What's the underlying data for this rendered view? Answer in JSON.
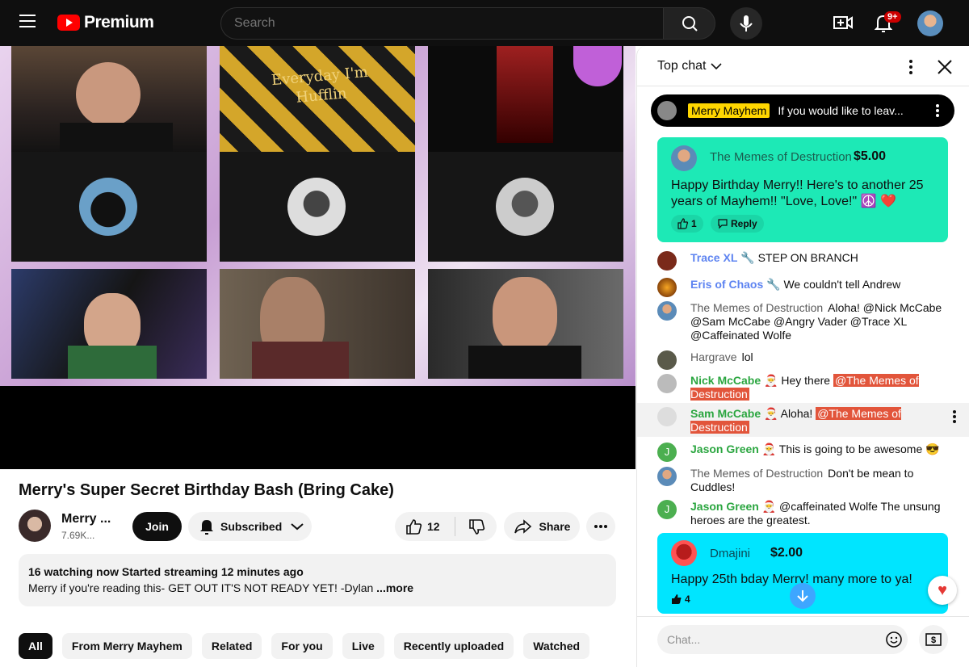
{
  "header": {
    "brand": "Premium",
    "search_placeholder": "Search",
    "notif_badge": "9+"
  },
  "video": {
    "tile_text": "Everyday I'm Hufflin"
  },
  "info": {
    "title": "Merry's Super Secret Birthday Bash (Bring Cake)",
    "channel": "Merry ...",
    "subscribers": "7.69K...",
    "join": "Join",
    "subscribed": "Subscribed",
    "likes": "12",
    "share": "Share",
    "desc_stats": "16 watching now  Started streaming 12 minutes ago",
    "desc_text": "Merry if you're reading this- GET OUT IT'S NOT READY YET! -Dylan",
    "desc_more": "...more"
  },
  "chips": [
    "All",
    "From Merry Mayhem",
    "Related",
    "For you",
    "Live",
    "Recently uploaded",
    "Watched"
  ],
  "chat": {
    "title": "Top chat",
    "pinned_author": "Merry Mayhem",
    "pinned_text": "If you would like to leav...",
    "input_placeholder": "Chat...",
    "superchat1": {
      "author": "The Memes of Destruction",
      "amount": "$5.00",
      "text": "Happy Birthday Merry!! Here's to another 25 years of Mayhem!! \"Love, Love!\" ☮️ ❤️",
      "likes": "1",
      "reply": "Reply"
    },
    "superchat2": {
      "author": "Dmajini",
      "amount": "$2.00",
      "text": "Happy 25th bday Merry! many more to ya!",
      "likes": "4"
    },
    "messages": [
      {
        "author": "Trace XL",
        "text": "STEP ON BRANCH"
      },
      {
        "author": "Eris of Chaos",
        "text": "We couldn't tell Andrew"
      },
      {
        "author": "The Memes of Destruction",
        "text": "Aloha! @Nick McCabe @Sam McCabe @Angry Vader @Trace XL @Caffeinated Wolfe"
      },
      {
        "author": "Hargrave",
        "text": "lol"
      },
      {
        "author": "Nick McCabe",
        "text": "Hey there",
        "mention": "@The Memes of Destruction"
      },
      {
        "author": "Sam McCabe",
        "text": "Aloha!",
        "mention": "@The Memes of Destruction"
      },
      {
        "author": "Jason Green",
        "text": "This is going to be awesome 😎"
      },
      {
        "author": "The Memes of Destruction",
        "text": "Don't be mean to Cuddles!"
      },
      {
        "author": "Jason Green",
        "text": "@caffeinated Wolfe The unsung heroes are the greatest."
      }
    ]
  },
  "colors": {
    "superchat1": "#1de9b6",
    "superchat2": "#00e5ff",
    "brand_red": "#ff0000"
  }
}
